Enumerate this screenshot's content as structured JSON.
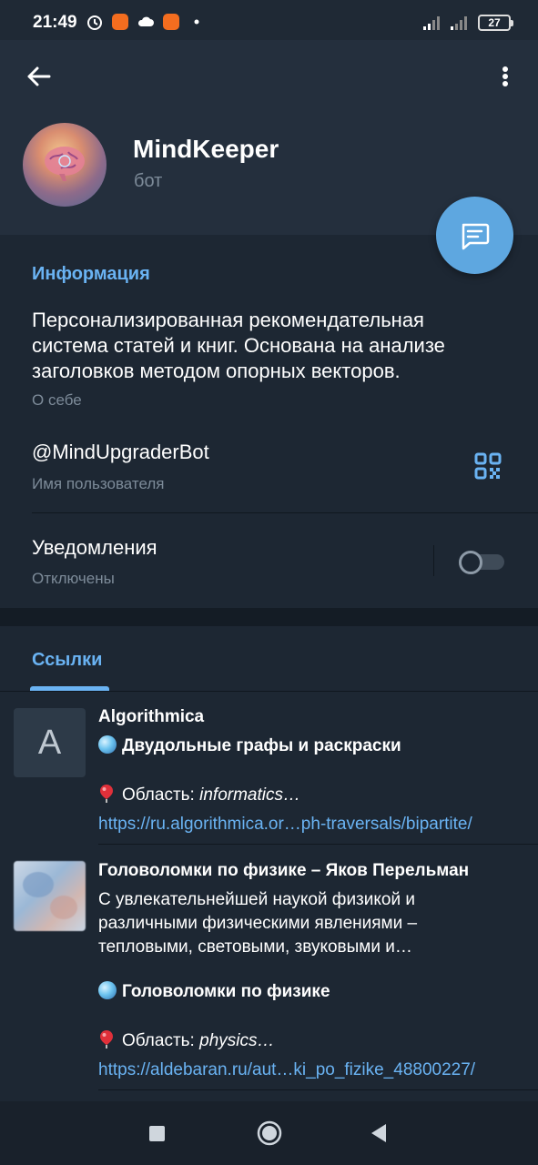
{
  "status_bar": {
    "time": "21:49",
    "battery": "27",
    "icons": [
      "alarm-icon",
      "mi-app-icon",
      "cloud-icon",
      "mi-app-icon",
      "dot-icon",
      "signal-icon",
      "signal-icon",
      "battery-icon"
    ]
  },
  "profile": {
    "name": "MindKeeper",
    "subtitle": "бот"
  },
  "info": {
    "section_title": "Информация",
    "about": "Персонализированная рекомендательная система статей и книг. Основана на анализе заголовков методом опорных векторов.",
    "about_label": "О себе",
    "username": "@MindUpgraderBot",
    "username_label": "Имя пользователя",
    "notifications": "Уведомления",
    "notifications_state": "Отключены",
    "notifications_on": false
  },
  "links": {
    "tab": "Ссылки",
    "items": [
      {
        "thumb_letter": "A",
        "title": "Algorithmica",
        "topic": "Двудольные графы и раскраски",
        "area_label": "Область:",
        "area": "informatics…",
        "url": "https://ru.algorithmica.or…ph-traversals/bipartite/"
      },
      {
        "title": "Головоломки по физике – Яков Перельман",
        "description": "С увлекательнейшей наукой физикой и различными физическими явлениями – тепловыми, световыми, звуковыми и…",
        "topic": "Головоломки по физике",
        "area_label": "Область:",
        "area": "physics…",
        "url": "https://aldebaran.ru/aut…ki_po_fizike_48800227/"
      }
    ]
  },
  "colors": {
    "accent": "#6ab3f3",
    "fab": "#5ea7e0",
    "background": "#1d2733",
    "header": "#242f3d"
  }
}
